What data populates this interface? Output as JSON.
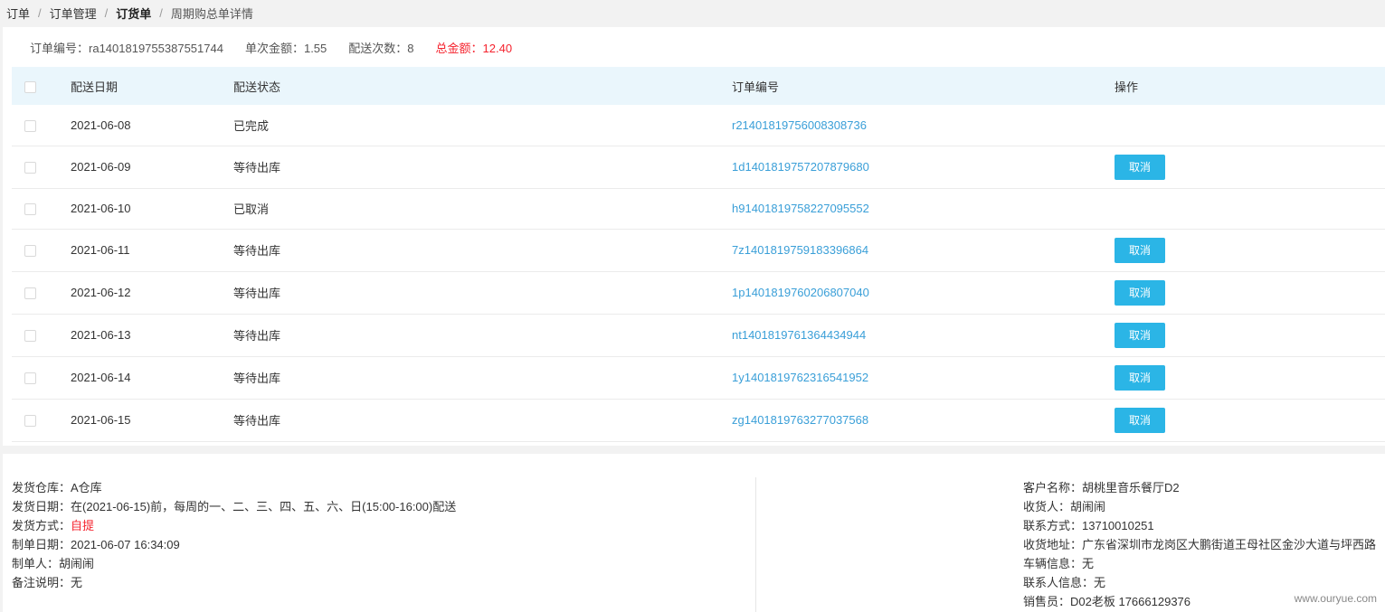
{
  "breadcrumb": [
    "订单",
    "订货单",
    "订货单",
    "周期购总单详情"
  ],
  "summary": {
    "order_no_label": "订单编号：",
    "order_no": "ra1401819755387551744",
    "unit_amount_label": "单次金额：",
    "unit_amount": "1.55",
    "delivery_times_label": "配送次数：",
    "delivery_times": "8",
    "total_label": "总金额：",
    "total": "12.40"
  },
  "table": {
    "headers": {
      "date": "配送日期",
      "status": "配送状态",
      "order_no": "订单编号",
      "actions": "操作"
    },
    "rows": [
      {
        "date": "2021-06-08",
        "status": "已完成",
        "order_no": "r21401819756008308736",
        "action": ""
      },
      {
        "date": "2021-06-09",
        "status": "等待出库",
        "order_no": "1d1401819757207879680",
        "action": "取消"
      },
      {
        "date": "2021-06-10",
        "status": "已取消",
        "order_no": "h91401819758227095552",
        "action": ""
      },
      {
        "date": "2021-06-11",
        "status": "等待出库",
        "order_no": "7z1401819759183396864",
        "action": "取消"
      },
      {
        "date": "2021-06-12",
        "status": "等待出库",
        "order_no": "1p1401819760206807040",
        "action": "取消"
      },
      {
        "date": "2021-06-13",
        "status": "等待出库",
        "order_no": "nt1401819761364434944",
        "action": "取消"
      },
      {
        "date": "2021-06-14",
        "status": "等待出库",
        "order_no": "1y1401819762316541952",
        "action": "取消"
      },
      {
        "date": "2021-06-15",
        "status": "等待出库",
        "order_no": "zg1401819763277037568",
        "action": "取消"
      }
    ]
  },
  "info_left": {
    "warehouse_label": "发货仓库：",
    "warehouse": "A仓库",
    "ship_date_label": "发货日期：",
    "ship_date": "在(2021-06-15)前，每周的一、二、三、四、五、六、日(15:00-16:00)配送",
    "ship_method_label": "发货方式：",
    "ship_method": "自提",
    "created_label": "制单日期：",
    "created": "2021-06-07 16:34:09",
    "creator_label": "制单人：",
    "creator": "胡闹闹",
    "remark_label": "备注说明：",
    "remark": "无"
  },
  "info_right": {
    "customer_label": "客户名称：",
    "customer": "胡桃里音乐餐厅D2",
    "receiver_label": "收货人：",
    "receiver": "胡闹闹",
    "contact_label": "联系方式：",
    "contact": "13710010251",
    "address_label": "收货地址：",
    "address": "广东省深圳市龙岗区大鹏街道王母社区金沙大道与坪西路",
    "vehicle_label": "车辆信息：",
    "vehicle": "无",
    "contact_person_label": "联系人信息：",
    "contact_person": "无",
    "sales_label": "销售员：",
    "sales": "D02老板 17666129376"
  },
  "watermark": "www.ouryue.com",
  "colors": {
    "accent": "#2bb5e6",
    "link": "#3a9fd8",
    "danger": "#f5222d",
    "header_bg": "#eaf6fc"
  }
}
